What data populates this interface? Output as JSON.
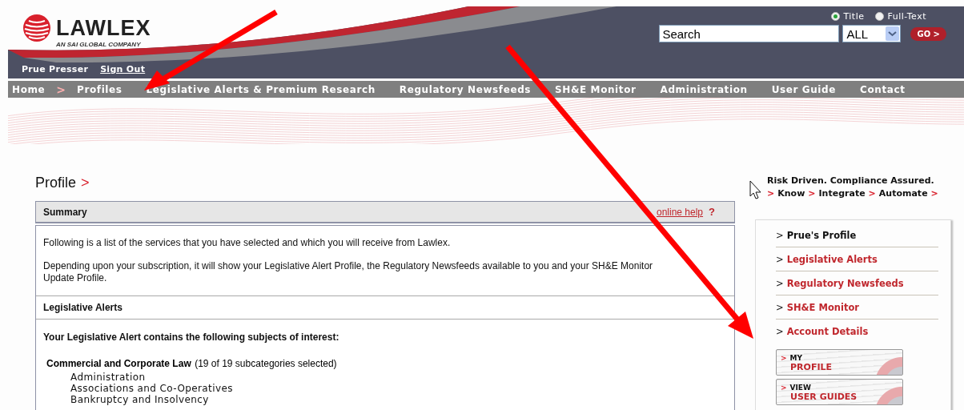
{
  "logo": {
    "name": "LAWLEX",
    "tagline": "AN SAI GLOBAL COMPANY"
  },
  "search": {
    "modes": [
      {
        "label": "Title",
        "selected": true
      },
      {
        "label": "Full-Text",
        "selected": false
      }
    ],
    "value": "Search",
    "scope": "ALL",
    "button": "GO >"
  },
  "user": {
    "name": "Prue Presser",
    "sign_out": "Sign Out"
  },
  "nav": [
    {
      "label": "Home",
      "kind": "link"
    },
    {
      "label": ">",
      "kind": "separator"
    },
    {
      "label": "Profiles",
      "kind": "link"
    },
    {
      "label": "Legislative Alerts & Premium Research",
      "kind": "link"
    },
    {
      "label": "Regulatory Newsfeeds",
      "kind": "link"
    },
    {
      "label": "SH&E Monitor",
      "kind": "link"
    },
    {
      "label": "Administration",
      "kind": "link"
    },
    {
      "label": "User Guide",
      "kind": "link"
    },
    {
      "label": "Contact",
      "kind": "link"
    }
  ],
  "page_title": {
    "text": "Profile",
    "mark": ">"
  },
  "summary": {
    "title": "Summary",
    "help_link": "online help",
    "help_icon": "?",
    "paragraphs": [
      "Following is a list of the services that you have selected and which you will receive from Lawlex.",
      "Depending upon your subscription, it will show your Legislative Alert Profile, the Regulatory Newsfeeds available to you and your SH&E Monitor Update Profile."
    ]
  },
  "legislative_alerts": {
    "title": "Legislative Alerts",
    "intro": "Your Legislative Alert contains the following subjects of interest:",
    "categories": [
      {
        "name": "Commercial and Corporate Law",
        "count": "(19 of 19 subcategories selected)",
        "children": [
          {
            "name": "Administration"
          },
          {
            "name": "Associations and Co-Operatives"
          },
          {
            "name": "Bankruptcy and Insolvency"
          }
        ]
      }
    ]
  },
  "tagline": {
    "headline": "Risk Driven. Compliance Assured.",
    "line": [
      {
        "text": ">",
        "kind": "marker"
      },
      {
        "text": "Know",
        "kind": "word"
      },
      {
        "text": ">",
        "kind": "marker"
      },
      {
        "text": "Integrate",
        "kind": "word"
      },
      {
        "text": ">",
        "kind": "marker"
      },
      {
        "text": "Automate",
        "kind": "word"
      },
      {
        "text": ">",
        "kind": "marker"
      }
    ]
  },
  "sidebar": {
    "items": [
      {
        "marker": ">",
        "label": "Prue's Profile",
        "selected": true
      },
      {
        "marker": ">",
        "label": "Legislative Alerts",
        "selected": false
      },
      {
        "marker": ">",
        "label": "Regulatory Newsfeeds",
        "selected": false
      },
      {
        "marker": ">",
        "label": "SH&E Monitor",
        "selected": false
      },
      {
        "marker": ">",
        "label": "Account Details",
        "selected": false
      }
    ],
    "buttons": [
      {
        "marker": ">",
        "top": "MY",
        "bottom": "PROFILE"
      },
      {
        "marker": ">",
        "top": "VIEW",
        "bottom": "USER GUIDES"
      }
    ]
  }
}
